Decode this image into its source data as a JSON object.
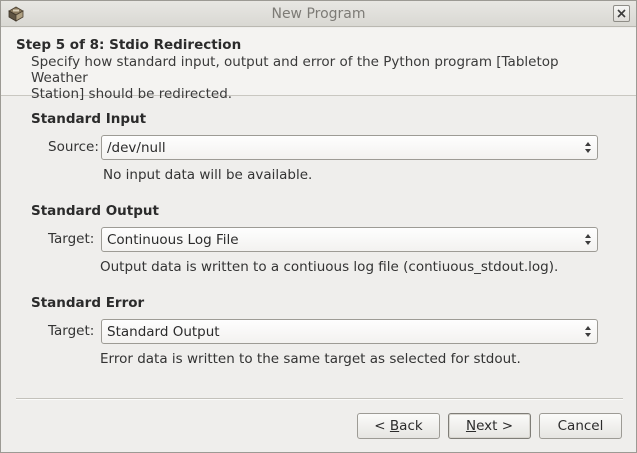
{
  "window": {
    "title": "New Program"
  },
  "header": {
    "step_title": "Step 5 of 8: Stdio Redirection",
    "description_line1": "Specify how standard input, output and error of the Python program [Tabletop Weather",
    "description_line2": "Station] should be redirected."
  },
  "standard_input": {
    "title": "Standard Input",
    "label": "Source:",
    "value": "/dev/null",
    "info": "No input data will be available."
  },
  "standard_output": {
    "title": "Standard Output",
    "label": "Target:",
    "value": "Continuous Log File",
    "info": "Output data is written to a contiuous log file (contiuous_stdout.log)."
  },
  "standard_error": {
    "title": "Standard Error",
    "label": "Target:",
    "value": "Standard Output",
    "info": "Error data is written to the same target as selected for stdout."
  },
  "buttons": {
    "back": {
      "prefix": "< ",
      "mnemonic": "B",
      "rest": "ack"
    },
    "next": {
      "mnemonic": "N",
      "rest": "ext >"
    },
    "cancel": "Cancel"
  }
}
